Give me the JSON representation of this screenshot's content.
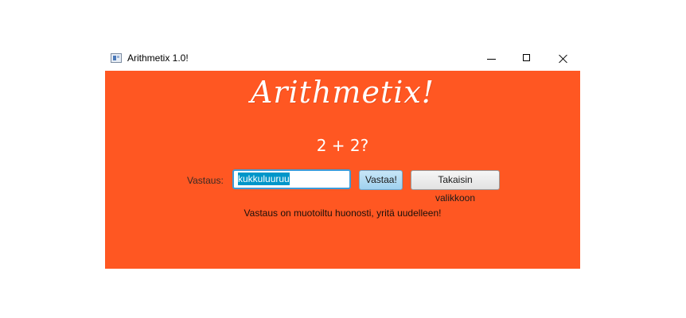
{
  "window": {
    "title": "Arithmetix 1.0!"
  },
  "app": {
    "logo_text": "Arithmetix!",
    "question": "2 + 2?",
    "answer_label": "Vastaus:",
    "answer_value": "kukkuluuruu",
    "answer_button": "Vastaa!",
    "back_button": "Takaisin valikkoon",
    "error_message": "Vastaus on muotoiltu huonosti, yritä uudelleen!"
  },
  "colors": {
    "background": "#ff5722",
    "selection": "#0096c9",
    "focus_border": "#3d9ad8"
  },
  "icons": {
    "app": "app-window-icon",
    "minimize": "minimize-icon",
    "maximize": "maximize-icon",
    "close": "close-icon"
  }
}
